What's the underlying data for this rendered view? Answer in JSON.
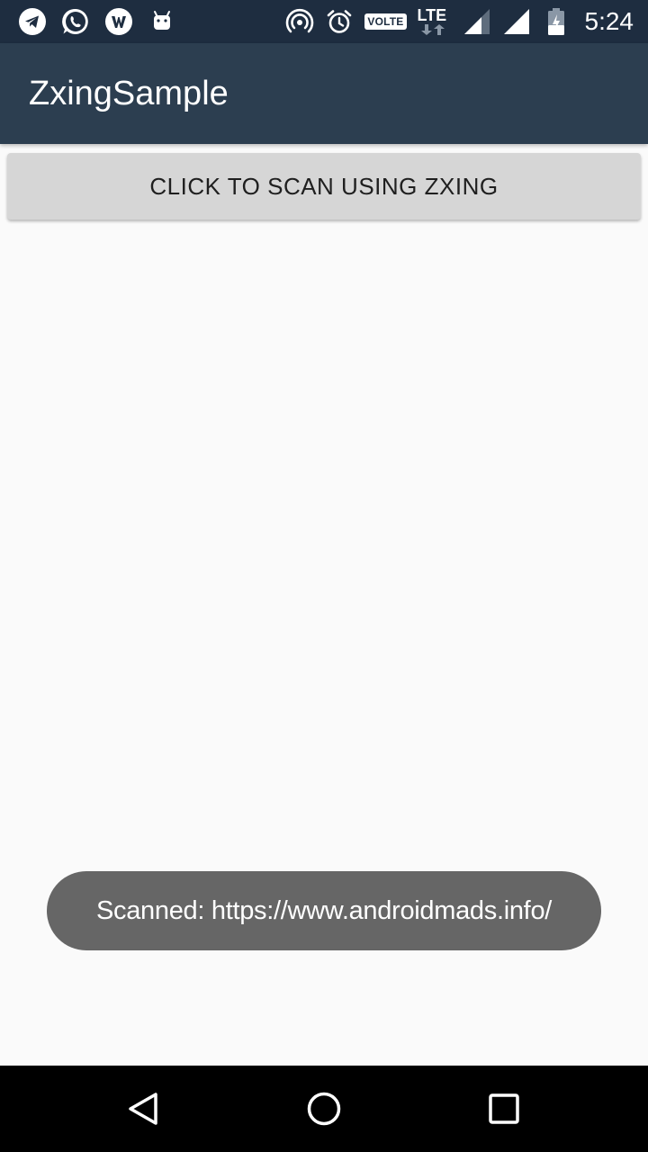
{
  "status_bar": {
    "left_icons": [
      "telegram-icon",
      "whatsapp-icon",
      "w-app-icon",
      "android-icon"
    ],
    "right_icons": [
      "hotspot-icon",
      "alarm-icon",
      "volte-badge",
      "lte-signal-icon",
      "signal-icon",
      "wifi-signal-icon",
      "battery-charging-icon"
    ],
    "volte_label": "VOLTE",
    "lte_label": "LTE",
    "time": "5:24"
  },
  "app_bar": {
    "title": "ZxingSample"
  },
  "main": {
    "scan_button_label": "CLICK TO SCAN USING ZXING"
  },
  "toast": {
    "message": "Scanned: https://www.androidmads.info/"
  },
  "nav_bar": {
    "icons": [
      "back-icon",
      "home-icon",
      "recents-icon"
    ]
  },
  "colors": {
    "status_bar": "#1e2d40",
    "app_bar": "#2c3e50",
    "background": "#fafafa",
    "button": "#d6d6d6",
    "toast": "#666666",
    "nav_bar": "#000000"
  }
}
